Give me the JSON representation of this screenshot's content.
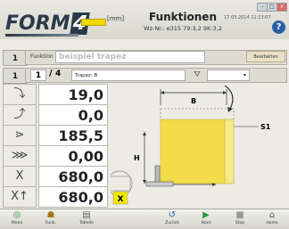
{
  "header": {
    "logo_main": "FORM",
    "logo_num": "4",
    "unit": "[mm]",
    "title": "Funktionen",
    "subtitle": "Wz-Nr.: e315 79:3,2 9K:3,2",
    "datetime": "17.03.2014 11:13:07",
    "help": "?",
    "win_min": "–",
    "win_max": "□",
    "win_close": "×"
  },
  "rows": {
    "r1_num": "1",
    "func_label": "Funktion",
    "func_value": "beispiel trapez",
    "edit_label": "Bearbeiten",
    "r2_num": "1",
    "page_cur": "1",
    "page_sep": "/",
    "page_tot": "4",
    "tool_value": "Trapez: B"
  },
  "values": [
    {
      "icon": "bend-angle-icon",
      "glyph": "⤵",
      "value": "19,0"
    },
    {
      "icon": "backgauge-icon",
      "glyph": "⤴",
      "value": "0,0"
    },
    {
      "icon": "angle-icon",
      "glyph": "⋗",
      "value": "185,5"
    },
    {
      "icon": "offset-icon",
      "glyph": "⋙",
      "value": "0,00"
    },
    {
      "icon": "x-axis-icon",
      "glyph": "X",
      "value": "680,0"
    },
    {
      "icon": "x-axis-2-icon",
      "glyph": "X↑",
      "value": "680,0"
    }
  ],
  "drawing": {
    "label_b": "B",
    "label_h": "H",
    "label_s1": "S1",
    "label_x": "X",
    "fill_color": "#f2dc4a",
    "accent": "#f0e800"
  },
  "toolbar": [
    {
      "name": "menu-button",
      "icon": "menu-icon",
      "glyph": "◎",
      "label": "Menü"
    },
    {
      "name": "functions-button",
      "icon": "functions-icon",
      "glyph": "☗",
      "label": "Funk."
    },
    {
      "name": "table-button",
      "icon": "table-icon",
      "glyph": "▤",
      "label": "Tabelle"
    },
    {
      "name": "back-button",
      "icon": "back-icon",
      "glyph": "↺",
      "label": "Zurück"
    },
    {
      "name": "start-button",
      "icon": "start-icon",
      "glyph": "▶",
      "label": "Start"
    },
    {
      "name": "stop-button",
      "icon": "stop-icon",
      "glyph": "■",
      "label": "Stop"
    },
    {
      "name": "home-button",
      "icon": "home-icon",
      "glyph": "⌂",
      "label": "Home"
    }
  ]
}
